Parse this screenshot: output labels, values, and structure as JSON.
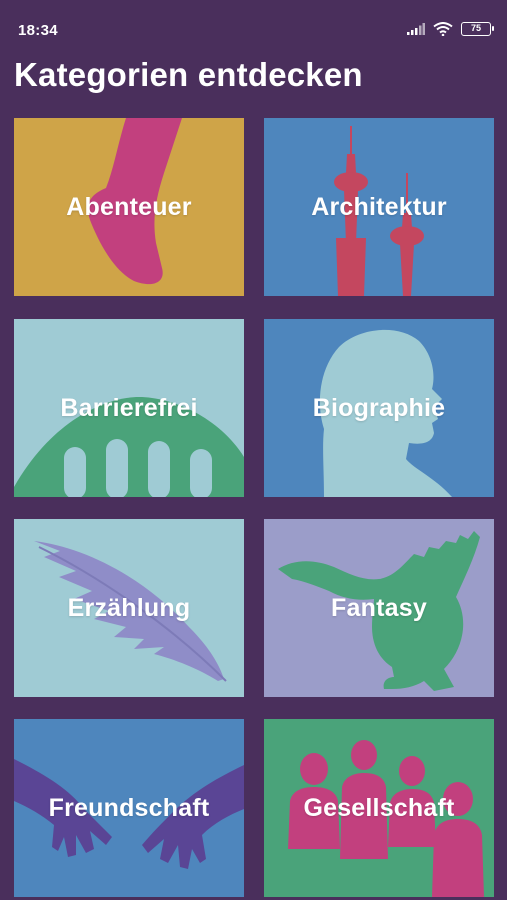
{
  "status_bar": {
    "time": "18:34",
    "battery_level": "75",
    "icons": [
      "signal-icon",
      "wifi-icon",
      "battery-icon"
    ]
  },
  "page": {
    "title": "Kategorien entdecken"
  },
  "categories": [
    {
      "label": "Abenteuer",
      "background": "#cfa448",
      "art_color": "#c2407e",
      "icon": "foot-icon"
    },
    {
      "label": "Architektur",
      "background": "#4e86bd",
      "art_color": "#c4475f",
      "icon": "tv-tower-icon"
    },
    {
      "label": "Barrierefrei",
      "background": "#9fcbd4",
      "art_color": "#4aa37a",
      "icon": "bridge-icon"
    },
    {
      "label": "Biographie",
      "background": "#4e86bd",
      "art_color": "#9fcbd4",
      "icon": "head-silhouette-icon"
    },
    {
      "label": "Erzählung",
      "background": "#9fcbd4",
      "art_color": "#8f8dc8",
      "icon": "feather-icon"
    },
    {
      "label": "Fantasy",
      "background": "#9b9dc9",
      "art_color": "#4aa37a",
      "icon": "dragon-icon"
    },
    {
      "label": "Freundschaft",
      "background": "#4e86bd",
      "art_color": "#5a4595",
      "icon": "hands-icon"
    },
    {
      "label": "Gesellschaft",
      "background": "#4aa37a",
      "art_color": "#c2407e",
      "icon": "people-icon"
    }
  ]
}
